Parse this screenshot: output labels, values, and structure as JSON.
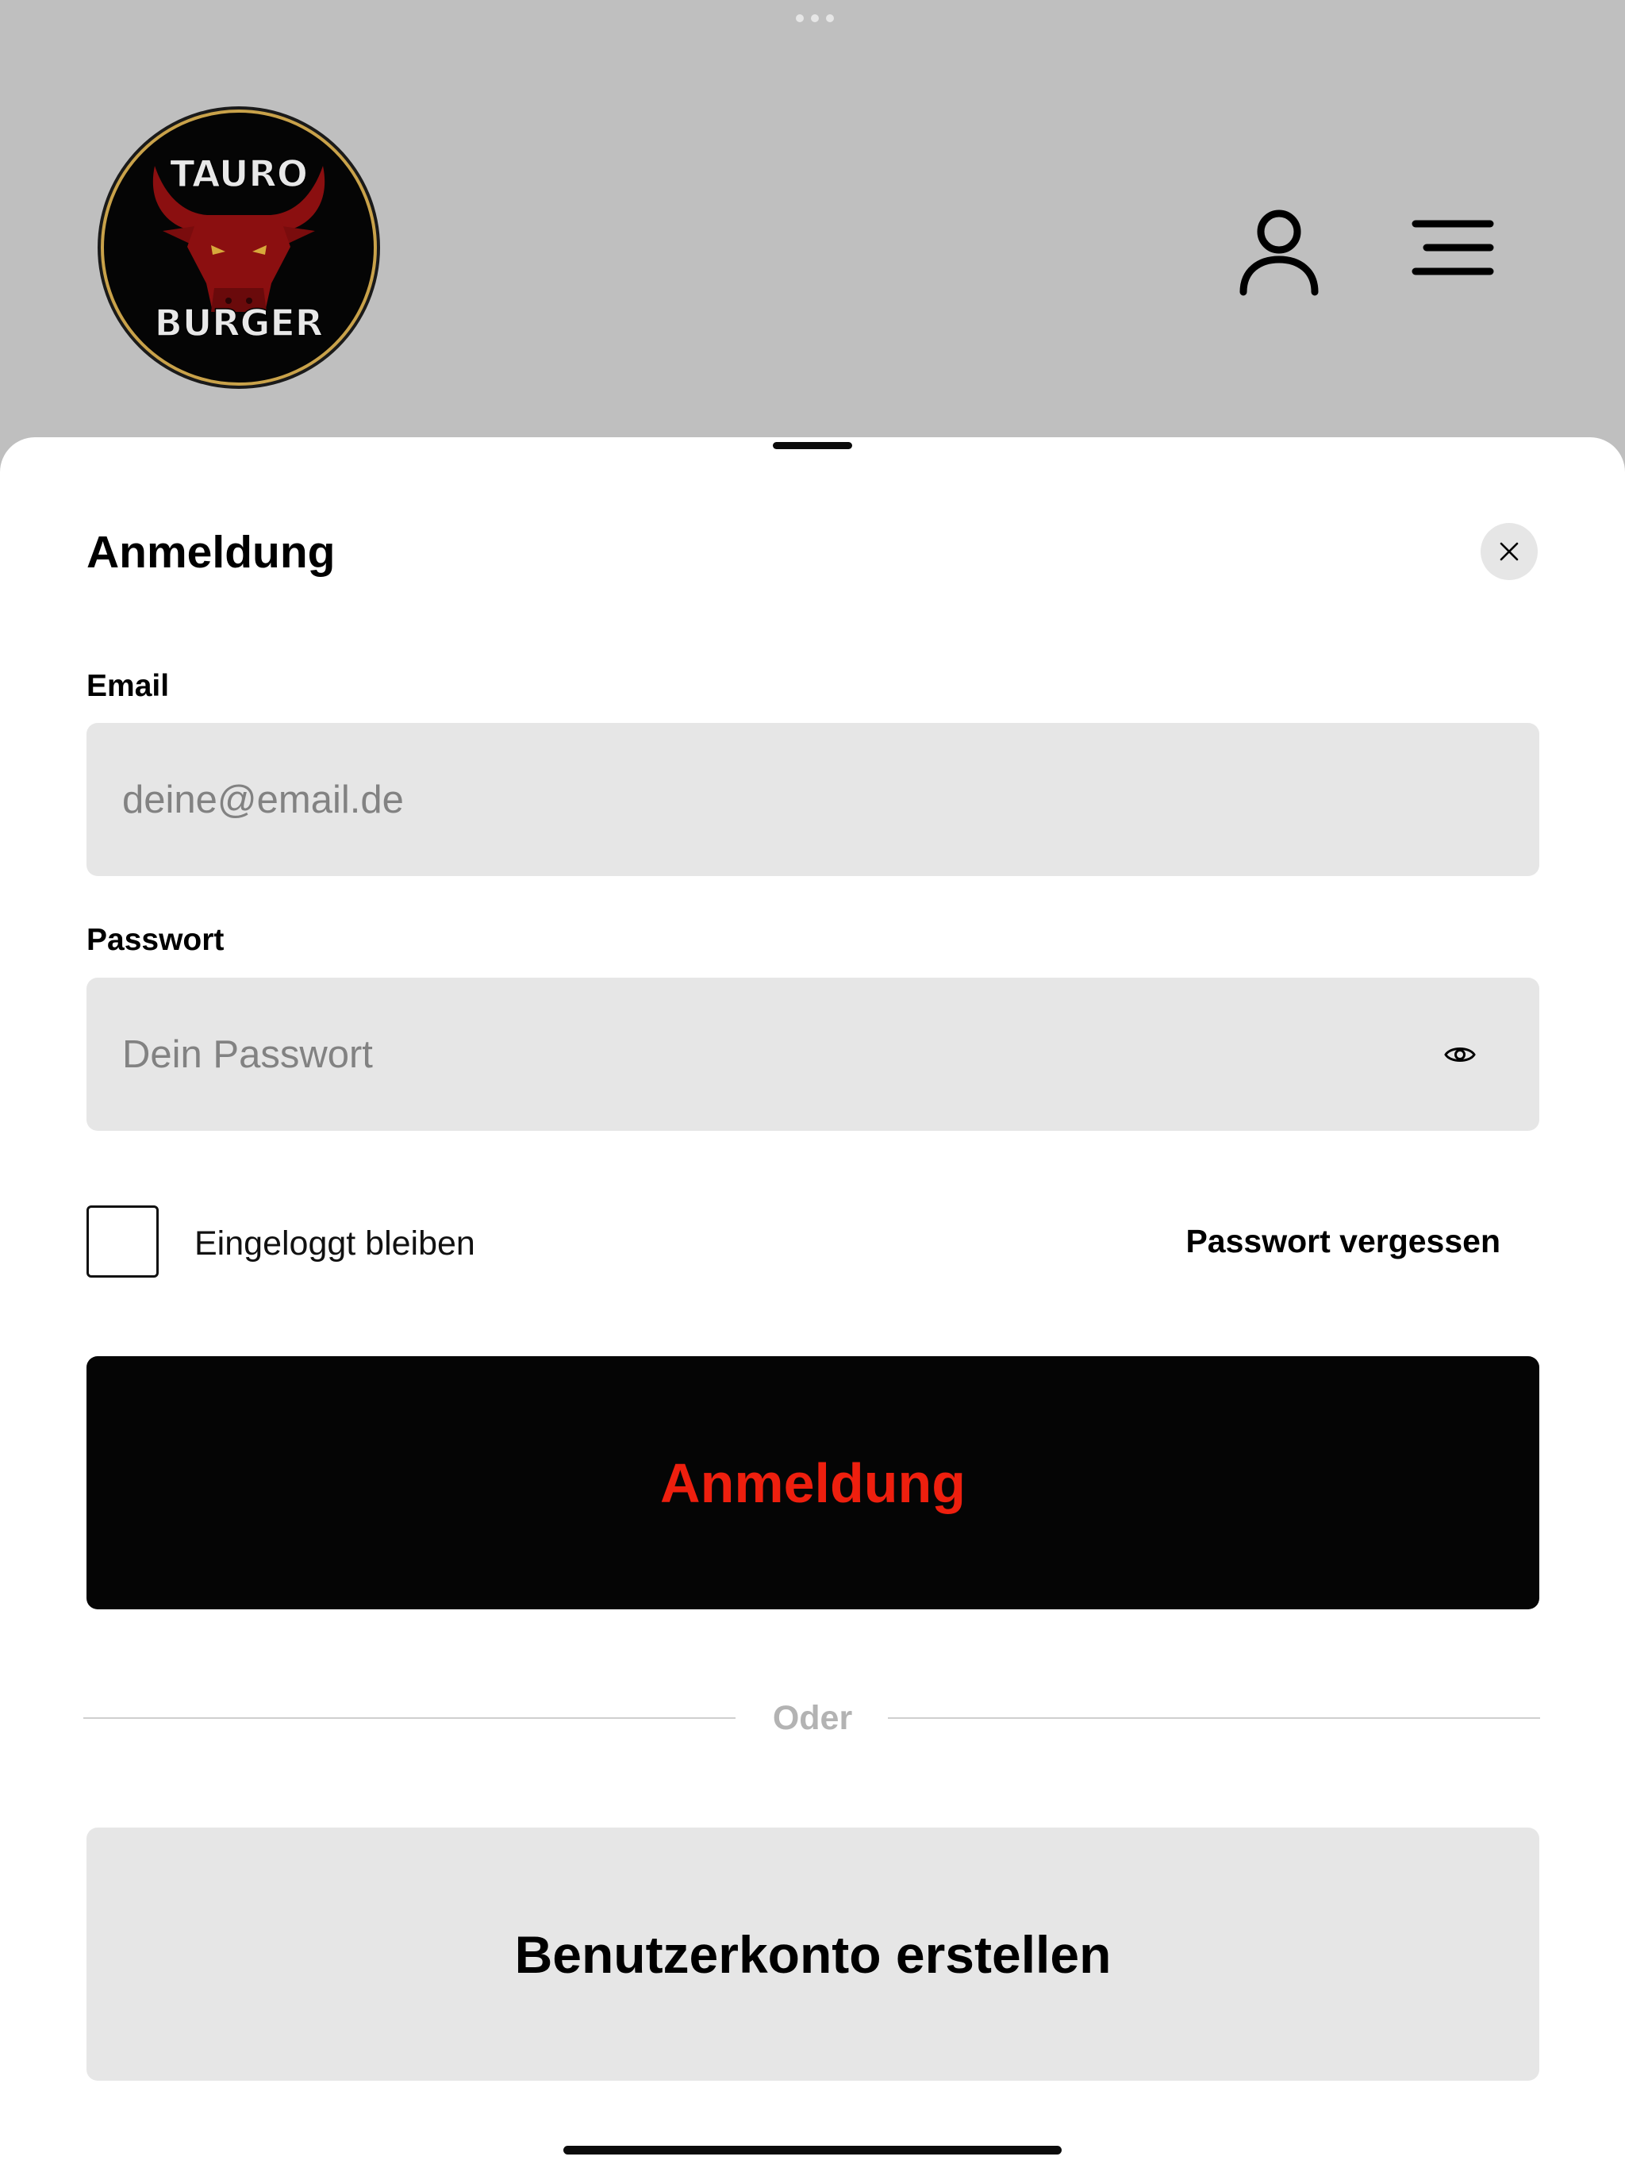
{
  "header": {
    "logo": {
      "line1": "TAURO",
      "line2": "BURGER"
    },
    "account_icon": "user-icon",
    "menu_icon": "menu-icon"
  },
  "login_sheet": {
    "title": "Anmeldung",
    "close_icon": "close-icon",
    "email": {
      "label": "Email",
      "placeholder": "deine@email.de",
      "value": ""
    },
    "password": {
      "label": "Passwort",
      "placeholder": "Dein Passwort",
      "value": "",
      "toggle_icon": "eye-icon"
    },
    "remember_me": {
      "label": "Eingeloggt bleiben",
      "checked": false
    },
    "forgot_password_label": "Passwort vergessen",
    "login_button_label": "Anmeldung",
    "divider_label": "Oder",
    "register_button_label": "Benutzerkonto erstellen"
  },
  "colors": {
    "header_background": "#bfbfbf",
    "sheet_background": "#ffffff",
    "input_background": "#e6e6e6",
    "login_button_background": "#050505",
    "login_button_text": "#ee1f0e",
    "divider_text": "#b3b3b3",
    "logo_bull": "#8b0f10",
    "logo_ring": "#c9a24a"
  }
}
